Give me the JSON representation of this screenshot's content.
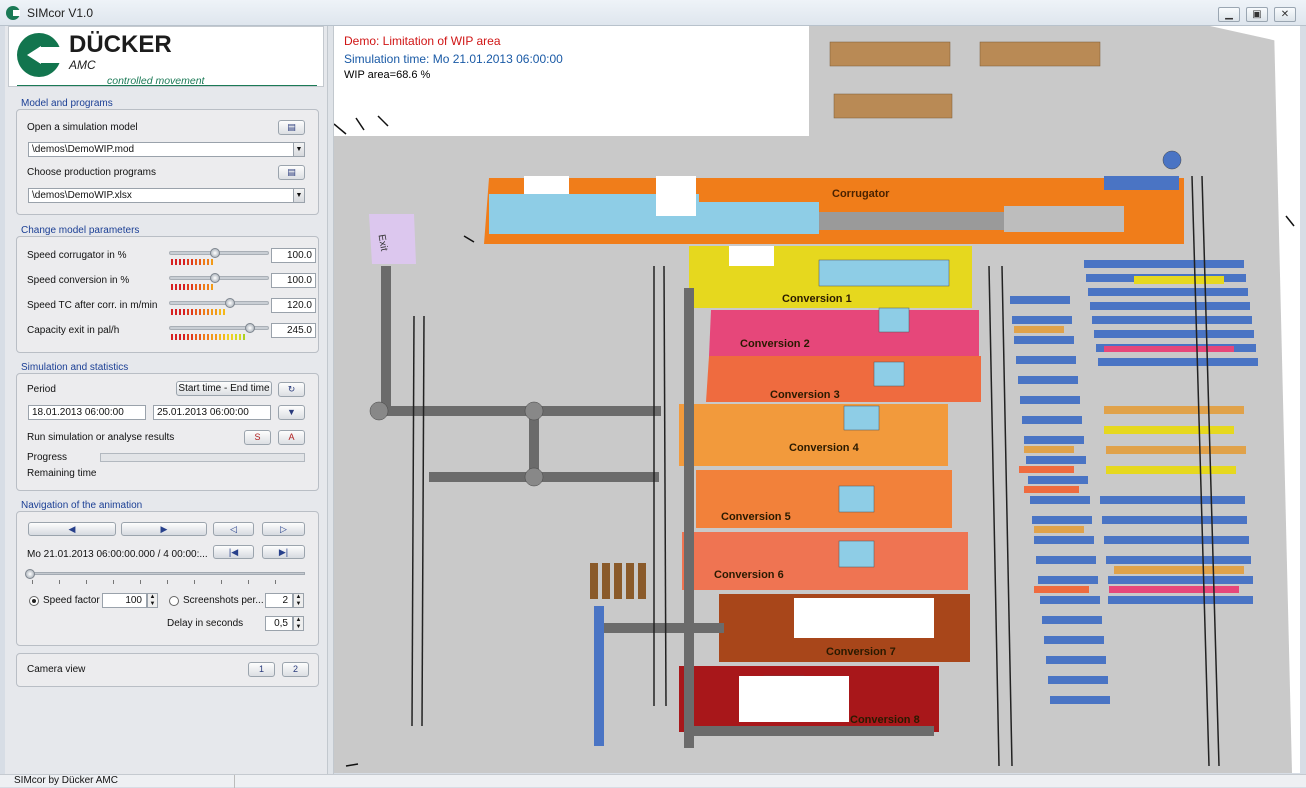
{
  "window": {
    "title": "SIMcor V1.0",
    "minimize": "▁",
    "maximize": "▣",
    "close": "✕"
  },
  "logo": {
    "name": "DÜCKER",
    "sub": "AMC",
    "tagline": "controlled movement"
  },
  "model": {
    "section": "Model and programs",
    "open_label": "Open a simulation model",
    "open_path": "\\demos\\DemoWIP.mod",
    "programs_label": "Choose production programs",
    "programs_path": "\\demos\\DemoWIP.xlsx"
  },
  "params": {
    "section": "Change model parameters",
    "items": [
      {
        "label": "Speed corrugator in %",
        "value": "100.0",
        "level": 0.45
      },
      {
        "label": "Speed conversion in %",
        "value": "100.0",
        "level": 0.45
      },
      {
        "label": "Speed TC after corr. in m/min",
        "value": "120.0",
        "level": 0.6
      },
      {
        "label": "Capacity exit in pal/h",
        "value": "245.0",
        "level": 0.8
      }
    ]
  },
  "simulation": {
    "section": "Simulation and statistics",
    "period_label": "Period",
    "period_button": "Start time - End time",
    "start": "18.01.2013 06:00:00",
    "end": "25.01.2013 06:00:00",
    "run_label": "Run simulation or analyse results",
    "progress_label": "Progress",
    "progress": 0,
    "remaining_label": "Remaining time"
  },
  "navigation": {
    "section": "Navigation of the animation",
    "timestamp": "Mo 21.01.2013 06:00:00.000 / 4 00:00:...",
    "speed_factor_label": "Speed factor",
    "speed_factor_value": "100",
    "screenshots_label": "Screenshots per...",
    "screenshots_value": "2",
    "delay_label": "Delay in seconds",
    "delay_value": "0,5",
    "position": 0
  },
  "camera": {
    "label": "Camera view",
    "btn1": "1",
    "btn2": "2"
  },
  "overlay": {
    "demo": "Demo: Limitation of WIP area",
    "time": "Simulation time: Mo 21.01.2013 06:00:00",
    "wip": "WIP area=68.6 %"
  },
  "plant": {
    "exit": "Exit",
    "corrugator": "Corrugator",
    "conversions": [
      "Conversion 1",
      "Conversion 2",
      "Conversion 3",
      "Conversion 4",
      "Conversion 5",
      "Conversion 6",
      "Conversion 7",
      "Conversion 8"
    ]
  },
  "colors": {
    "corrugator": "#f07d1a",
    "conv1": "#e6d81e",
    "conv2": "#e6477a",
    "conv3": "#ef6b3f",
    "conv4": "#f29a3c",
    "conv5": "#f2813a",
    "conv6": "#ef7452",
    "conv7": "#a8461a",
    "conv8": "#a8171a",
    "floor": "#c8c8c8",
    "conveyor": "#4a74c4"
  },
  "status": {
    "text": "SIMcor by Dücker AMC"
  }
}
